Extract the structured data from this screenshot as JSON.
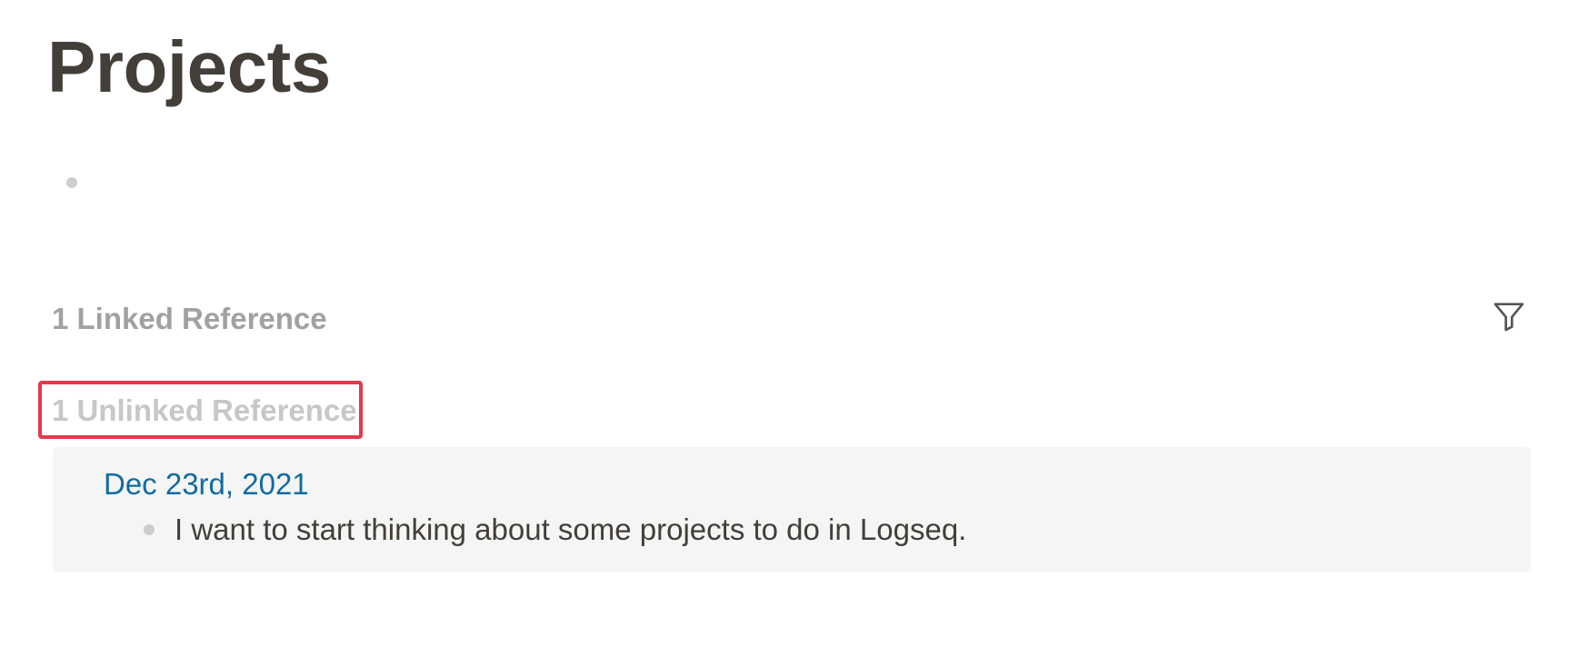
{
  "page": {
    "title": "Projects"
  },
  "references": {
    "linked_heading": "1 Linked Reference",
    "unlinked_heading": "1 Unlinked Reference",
    "filter_icon": "filter-icon",
    "unlinked": [
      {
        "page_link": "Dec 23rd, 2021",
        "block_text": "I want to start thinking about some projects to do in Logseq."
      }
    ]
  },
  "colors": {
    "title": "#433f38",
    "linked_heading": "#a1a1a0",
    "unlinked_heading": "#c7c7c6",
    "link": "#106ba3",
    "highlight": "#e5394a",
    "panel_bg": "#f5f5f5"
  }
}
